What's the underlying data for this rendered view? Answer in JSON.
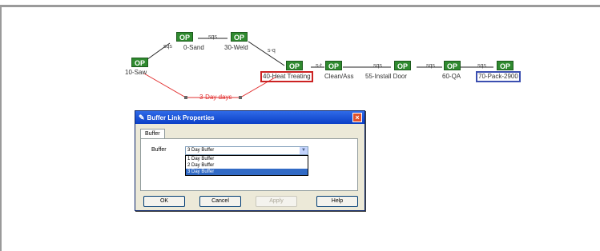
{
  "flow": {
    "op_label": "OP",
    "steps": [
      {
        "id": "saw",
        "label": "10-Saw"
      },
      {
        "id": "sand",
        "label": "0-Sand"
      },
      {
        "id": "weld",
        "label": "30-Weld"
      },
      {
        "id": "heat",
        "label": "40-Heat Treating"
      },
      {
        "id": "clean",
        "label": "Clean/Ass"
      },
      {
        "id": "install",
        "label": "55-Install Door"
      },
      {
        "id": "qa",
        "label": "60-QA"
      },
      {
        "id": "pack",
        "label": "70-Pack-2900"
      }
    ],
    "seq_labels": [
      "sqs",
      "sqs",
      "sqs",
      "s-q",
      "s-t",
      "sqs",
      "sqs",
      "sqs"
    ],
    "buffer_link_label": "3-Day days"
  },
  "dialog": {
    "title": "Buffer Link Properties",
    "close_label": "×",
    "tab_label": "Buffer",
    "field_label": "Buffer",
    "selected_value": "3 Day Buffer",
    "dropdown_arrow": "▼",
    "options": [
      "1 Day Buffer",
      "2 Day Buffer",
      "3 Day Buffer"
    ],
    "selected_index": 2,
    "buttons": {
      "ok": "OK",
      "cancel": "Cancel",
      "apply": "Apply",
      "help": "Help"
    }
  },
  "colors": {
    "op_green": "#2f8a2f",
    "highlight_red": "#cc2222",
    "highlight_blue": "#3b4fb0",
    "buffer_line": "#e23030"
  }
}
